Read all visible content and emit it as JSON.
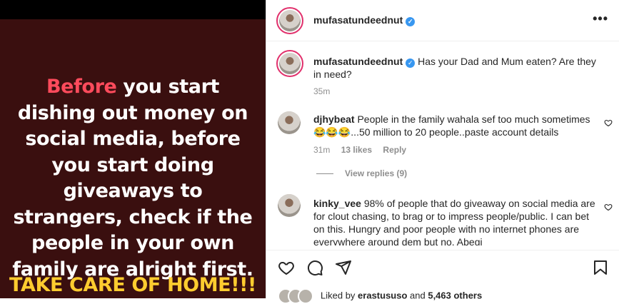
{
  "post": {
    "highlight_word": "Before",
    "body_text": " you start dishing out money on social media, before you start doing giveaways to strangers, check if the people in your own family are alright first.",
    "cta": "TAKE CARE OF HOME!!!"
  },
  "header": {
    "username": "mufasatundeednut",
    "verified_glyph": "✓",
    "more_glyph": "•••"
  },
  "caption": {
    "username": "mufasatundeednut",
    "text": "Has your Dad and Mum eaten? Are they in need?",
    "time": "35m"
  },
  "comments": [
    {
      "username": "djhybeat",
      "text": "People in the family wahala sef too much sometimes 😂😂😂...50 million to 20 people..paste account details",
      "time": "31m",
      "likes": "13 likes",
      "reply": "Reply"
    },
    {
      "username": "kinky_vee",
      "text": "98% of people that do giveaway on social media are for clout chasing, to brag or to impress people/public. I can bet on this. Hungry and poor people with no internet phones are everywhere around dem but no. Abegi"
    }
  ],
  "view_replies": "View replies (9)",
  "likes_line": {
    "prefix": "Liked by ",
    "user": "erastususo",
    "middle": " and ",
    "others": "5,463 others"
  },
  "icons": [
    "more-icon",
    "verified-icon",
    "heart-icon",
    "comment-icon",
    "share-icon",
    "bookmark-icon"
  ],
  "colors": {
    "highlight": "#ff4b5c",
    "cta": "#ffcc2f",
    "verified": "#3897f0",
    "image_bg": "#3a0f0f"
  }
}
